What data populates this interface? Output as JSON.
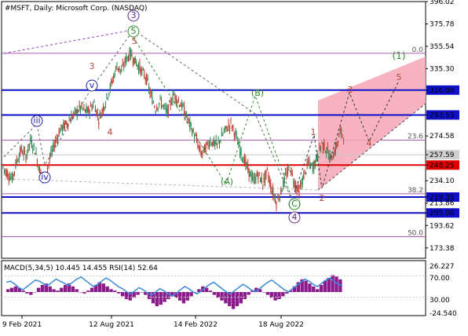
{
  "colors": {
    "background": "#ffffff",
    "frame": "#000000",
    "bull_candle": "#2e8b57",
    "bear_candle": "#c0392b",
    "blue_level": "#1010c8",
    "red_level": "#e00000",
    "fib_line": "#b05bb0",
    "wave_green": "#2e8b2e",
    "wave_brown": "#b4463a",
    "wave_purple": "#5a2a8a",
    "wave_blue": "#1e1ea0",
    "channel_fill": "#f7a6b6",
    "macd_hist": "#8b1a8b",
    "rsi_line": "#3a8ad8"
  },
  "chart_data": {
    "type": "candlestick",
    "title": "#MSFT, Daily:  Microsoft Corp. (NASDAQ)",
    "ylim": [
      164.0,
      396.02
    ],
    "price_axis_ticks": [
      "396.02",
      "375.78",
      "355.54",
      "335.30",
      "316.00",
      "293.53",
      "274.58",
      "257.59",
      "248.25",
      "234.10",
      "219.35",
      "213.86",
      "205.00",
      "193.62",
      "173.38"
    ],
    "x_tick_labels": [
      "9 Feb 2021",
      "12 Aug 2021",
      "14 Feb 2022",
      "18 Aug 2022"
    ],
    "price_path": [
      [
        0,
        246
      ],
      [
        4,
        240
      ],
      [
        8,
        236
      ],
      [
        12,
        252
      ],
      [
        16,
        262
      ],
      [
        20,
        256
      ],
      [
        24,
        270
      ],
      [
        28,
        262
      ],
      [
        32,
        244
      ],
      [
        36,
        234
      ],
      [
        40,
        250
      ],
      [
        44,
        264
      ],
      [
        50,
        280
      ],
      [
        56,
        286
      ],
      [
        62,
        294
      ],
      [
        68,
        300
      ],
      [
        74,
        296
      ],
      [
        80,
        304
      ],
      [
        84,
        290
      ],
      [
        88,
        300
      ],
      [
        94,
        318
      ],
      [
        100,
        338
      ],
      [
        104,
        333
      ],
      [
        108,
        344
      ],
      [
        112,
        349
      ],
      [
        116,
        342
      ],
      [
        120,
        336
      ],
      [
        126,
        326
      ],
      [
        130,
        310
      ],
      [
        134,
        300
      ],
      [
        138,
        306
      ],
      [
        144,
        296
      ],
      [
        150,
        312
      ],
      [
        154,
        306
      ],
      [
        158,
        300
      ],
      [
        162,
        290
      ],
      [
        166,
        280
      ],
      [
        170,
        270
      ],
      [
        174,
        258
      ],
      [
        178,
        264
      ],
      [
        182,
        270
      ],
      [
        188,
        266
      ],
      [
        194,
        278
      ],
      [
        200,
        286
      ],
      [
        204,
        276
      ],
      [
        208,
        262
      ],
      [
        212,
        252
      ],
      [
        216,
        242
      ],
      [
        220,
        234
      ],
      [
        224,
        240
      ],
      [
        228,
        232
      ],
      [
        232,
        242
      ],
      [
        236,
        226
      ],
      [
        240,
        215
      ],
      [
        244,
        224
      ],
      [
        248,
        238
      ],
      [
        252,
        246
      ],
      [
        256,
        232
      ],
      [
        260,
        224
      ],
      [
        264,
        238
      ],
      [
        268,
        250
      ],
      [
        272,
        246
      ],
      [
        276,
        256
      ],
      [
        280,
        268
      ],
      [
        284,
        262
      ],
      [
        288,
        254
      ],
      [
        292,
        262
      ],
      [
        296,
        278
      ],
      [
        300,
        274
      ]
    ],
    "horizontal_levels": [
      {
        "label": "316.00",
        "value": 316.0,
        "kind": "blue"
      },
      {
        "label": "293.53",
        "value": 293.53,
        "kind": "blue"
      },
      {
        "label": "257.59",
        "value": 257.59,
        "kind": "current"
      },
      {
        "label": "248.25",
        "value": 248.25,
        "kind": "red"
      },
      {
        "label": "219.35",
        "value": 219.35,
        "kind": "blue"
      },
      {
        "label": "205.00",
        "value": 205.0,
        "kind": "blue"
      }
    ],
    "fibonacci": [
      {
        "label": "0.0",
        "value": 349.3
      },
      {
        "label": "23.6",
        "value": 270.8
      },
      {
        "label": "38.2",
        "value": 222.3
      },
      {
        "label": "50.0",
        "value": 183.5
      }
    ],
    "wave_labels": [
      {
        "text": "(1)",
        "color": "wave_green",
        "big": true
      },
      {
        "text": "3",
        "color": "wave_purple",
        "circle": true
      },
      {
        "text": "5",
        "color": "wave_green",
        "circle": true
      },
      {
        "text": "5",
        "color": "wave_brown"
      },
      {
        "text": "3",
        "color": "wave_brown"
      },
      {
        "text": "v",
        "color": "wave_blue",
        "circle": true
      },
      {
        "text": "iii",
        "color": "wave_blue",
        "circle": true
      },
      {
        "text": "iv",
        "color": "wave_blue",
        "circle": true
      },
      {
        "text": "4",
        "color": "wave_brown"
      },
      {
        "text": "(B)",
        "color": "wave_green"
      },
      {
        "text": "(A)",
        "color": "wave_green"
      },
      {
        "text": "(C)",
        "color": "wave_green",
        "circle": true
      },
      {
        "text": "4",
        "color": "wave_purple",
        "circle": true
      },
      {
        "text": "1",
        "color": "wave_brown"
      },
      {
        "text": "2",
        "color": "wave_brown"
      },
      {
        "text": "3",
        "color": "wave_brown"
      },
      {
        "text": "4",
        "color": "wave_brown"
      },
      {
        "text": "5",
        "color": "wave_brown"
      }
    ],
    "indicator": {
      "label": "MACD(5,34,5) 10.445 14.455 RSI(14) 52.64",
      "axis_ticks": [
        "26.227",
        "70.00",
        "30.00",
        "-24.540"
      ],
      "macd_hist": [
        2,
        3,
        4,
        3,
        1,
        -1,
        -2,
        0,
        3,
        5,
        6,
        4,
        2,
        1,
        3,
        5,
        6,
        4,
        2,
        0,
        -1,
        1,
        3,
        5,
        7,
        6,
        4,
        2,
        1,
        -1,
        -3,
        -5,
        -6,
        -4,
        -2,
        0,
        -2,
        -5,
        -8,
        -10,
        -9,
        -7,
        -5,
        -3,
        -4,
        -6,
        -8,
        -6,
        -3,
        0,
        2,
        4,
        3,
        1,
        -2,
        -4,
        -6,
        -8,
        -10,
        -12,
        -10,
        -8,
        -5,
        -2,
        1,
        3,
        2,
        0,
        -2,
        -4,
        -6,
        -5,
        -3,
        -1,
        1,
        4,
        7,
        9,
        8,
        6,
        4,
        2,
        5,
        8,
        10,
        12,
        11,
        9
      ],
      "rsi": [
        58,
        60,
        55,
        48,
        44,
        50,
        56,
        62,
        60,
        55,
        52,
        58,
        64,
        60,
        56,
        52,
        58,
        64,
        68,
        62,
        56,
        50,
        54,
        60,
        66,
        62,
        56,
        50,
        46,
        40,
        36,
        42,
        48,
        44,
        38,
        34,
        40,
        46,
        42,
        36,
        32,
        38,
        44,
        50,
        46,
        40,
        36,
        42,
        48,
        54,
        58,
        52,
        46,
        40,
        36,
        42,
        48,
        54,
        50,
        44,
        40,
        46,
        52,
        58,
        62,
        56,
        50,
        44,
        40,
        46,
        52,
        58,
        64,
        60,
        54,
        50,
        56,
        62,
        66,
        60,
        54,
        52
      ]
    }
  }
}
